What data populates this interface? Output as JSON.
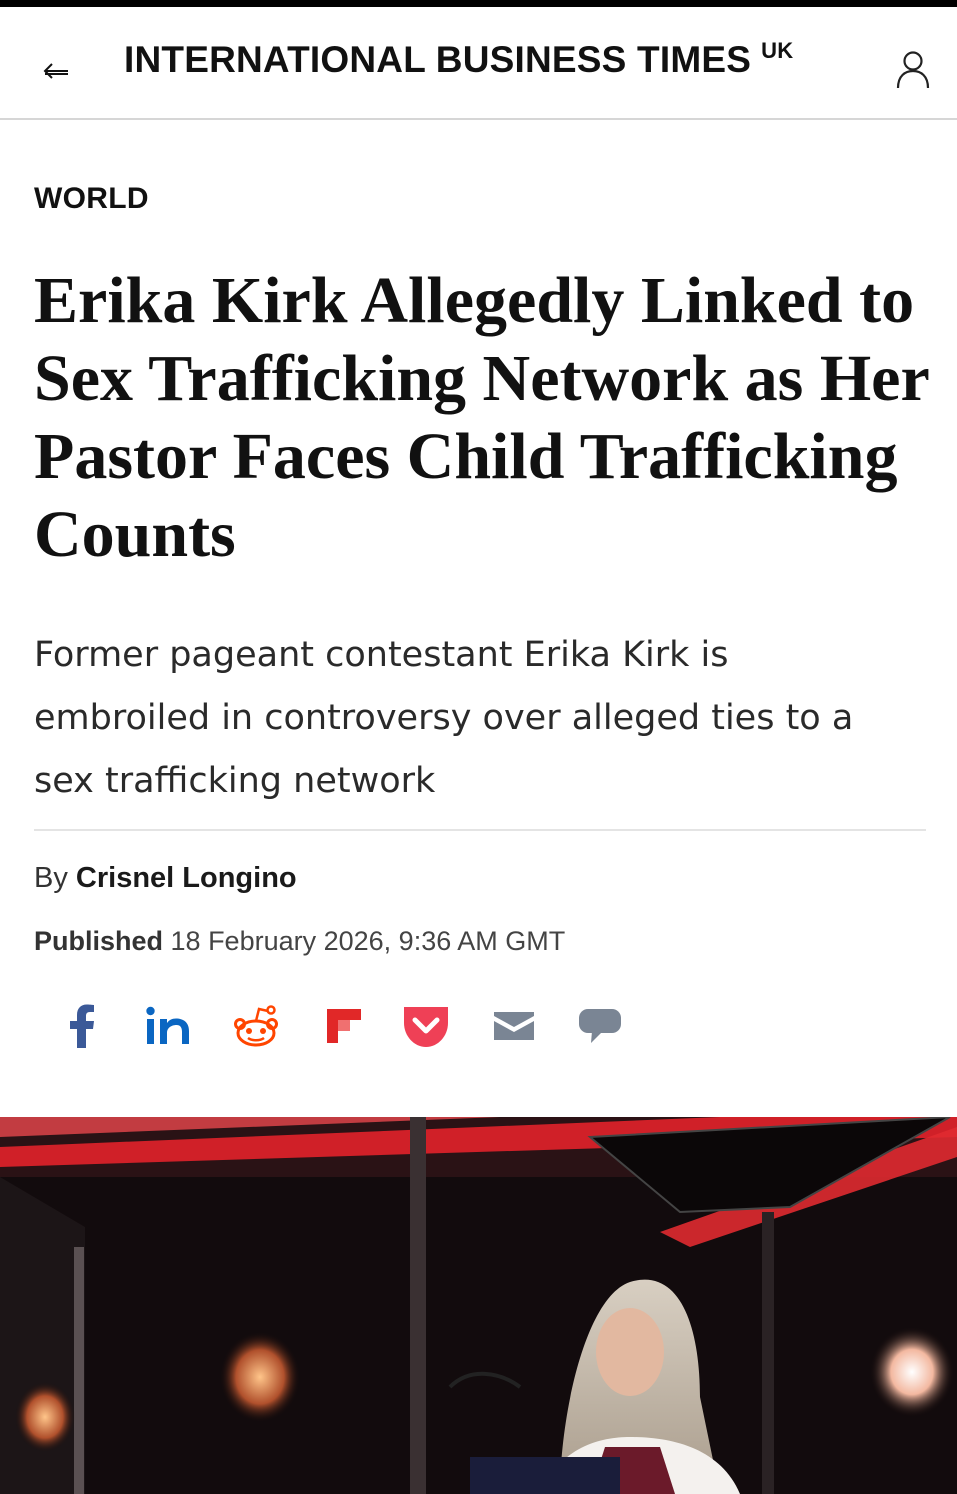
{
  "header": {
    "masthead": "INTERNATIONAL BUSINESS TIMES",
    "edition": "UK",
    "back_icon": "back-arrow-icon",
    "user_icon": "user-icon"
  },
  "article": {
    "category": "WORLD",
    "headline": "Erika Kirk Allegedly Linked to Sex Trafficking Network as Her Pastor Faces Child Trafficking Counts",
    "standfirst": "Former pageant contestant Erika Kirk is embroiled in controversy over alleged ties to a sex trafficking network",
    "byline_prefix": "By",
    "author": "Crisnel Longino",
    "published_label": "Published",
    "published_date": "18 February 2026, 9:36 AM GMT"
  },
  "share": [
    {
      "name": "facebook-share-icon",
      "color": "#3b5998"
    },
    {
      "name": "linkedin-share-icon",
      "color": "#0a66c2"
    },
    {
      "name": "reddit-share-icon",
      "color": "#ff4500"
    },
    {
      "name": "flipboard-share-icon",
      "color": "#e12828"
    },
    {
      "name": "pocket-share-icon",
      "color": "#ef4056"
    },
    {
      "name": "email-share-icon",
      "color": "#7a8594"
    },
    {
      "name": "comment-icon",
      "color": "#7a8594"
    }
  ],
  "colors": {
    "text": "#111111",
    "divider": "#e4e4e4",
    "topbar": "#000000"
  }
}
